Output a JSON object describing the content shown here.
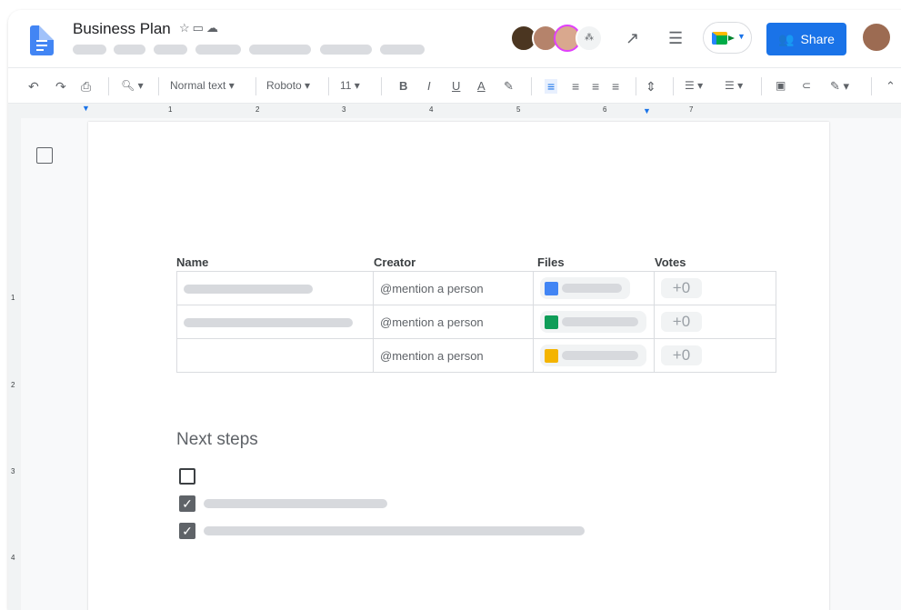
{
  "window": {
    "title": "Business Plan"
  },
  "toolbar": {
    "style": "Normal text",
    "font": "Roboto",
    "size": "11",
    "share_label": "Share"
  },
  "ruler": {
    "marks": [
      "1",
      "2",
      "3",
      "4",
      "5",
      "6",
      "7"
    ],
    "vmarks": [
      "1",
      "2",
      "3",
      "4"
    ]
  },
  "table": {
    "headers": [
      "Name",
      "Creator",
      "Files",
      "Votes"
    ],
    "rows": [
      {
        "creator": "@mention a person",
        "file_type": "docs",
        "votes": "+0"
      },
      {
        "creator": "@mention a person",
        "file_type": "sheets",
        "votes": "+0"
      },
      {
        "creator": "@mention a person",
        "file_type": "slides",
        "votes": "+0"
      }
    ]
  },
  "section": {
    "heading": "Next steps"
  },
  "checklist": [
    {
      "checked": false
    },
    {
      "checked": true
    },
    {
      "checked": true
    }
  ],
  "colors": {
    "accent": "#1a73e8",
    "docs": "#4285f4",
    "sheets": "#0f9d58",
    "slides": "#f4b400"
  }
}
